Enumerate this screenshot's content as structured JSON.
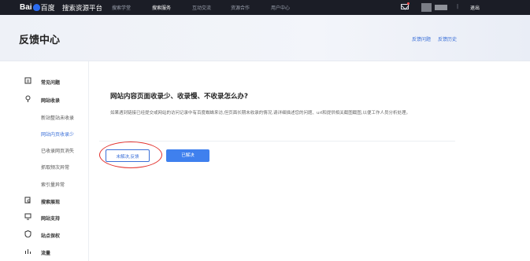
{
  "topnav": {
    "logo_bai": "Bai",
    "logo_du": "百度",
    "brand": "搜索资源平台",
    "items": [
      {
        "label": "搜索学堂",
        "active": false
      },
      {
        "label": "搜索服务",
        "active": true
      },
      {
        "label": "互动交流",
        "active": false
      },
      {
        "label": "资源合作",
        "active": false
      },
      {
        "label": "用户中心",
        "active": false
      }
    ],
    "separator": "|",
    "logout": "退出"
  },
  "header": {
    "title": "反馈中心",
    "links": [
      "反馈问题",
      "反馈历史"
    ]
  },
  "sidebar": {
    "items": [
      {
        "icon": "document-icon",
        "label": "常见问题"
      },
      {
        "icon": "pin-icon",
        "label": "网站收录",
        "children": [
          {
            "label": "新站整站未收录",
            "active": false
          },
          {
            "label": "网站内页收录少",
            "active": true
          },
          {
            "label": "已收录网页消失",
            "active": false
          },
          {
            "label": "抓取频次异常",
            "active": false
          },
          {
            "label": "索引量异常",
            "active": false
          }
        ]
      },
      {
        "icon": "search-doc-icon",
        "label": "搜索展现"
      },
      {
        "icon": "monitor-icon",
        "label": "网站支持"
      },
      {
        "icon": "shield-icon",
        "label": "站点保权"
      },
      {
        "icon": "chart-icon",
        "label": "流量"
      }
    ]
  },
  "content": {
    "question": "网站内容页面收录少、收录慢、不收录怎么办?",
    "description": "如果遇到链接已经提交或网站的访问记录中有百度蜘蛛来访,但页面长期未收录的情况,请详细描述您的问题、url和提供相关截图截图,以便工作人员分析处理。",
    "unsolved_button": "未解决,反馈",
    "solved_button": "已解决"
  },
  "colors": {
    "accent": "#3a6fd8",
    "primary_button": "#3f80ee",
    "highlight_circle": "#e2302c",
    "topbar": "#1b1d26"
  }
}
